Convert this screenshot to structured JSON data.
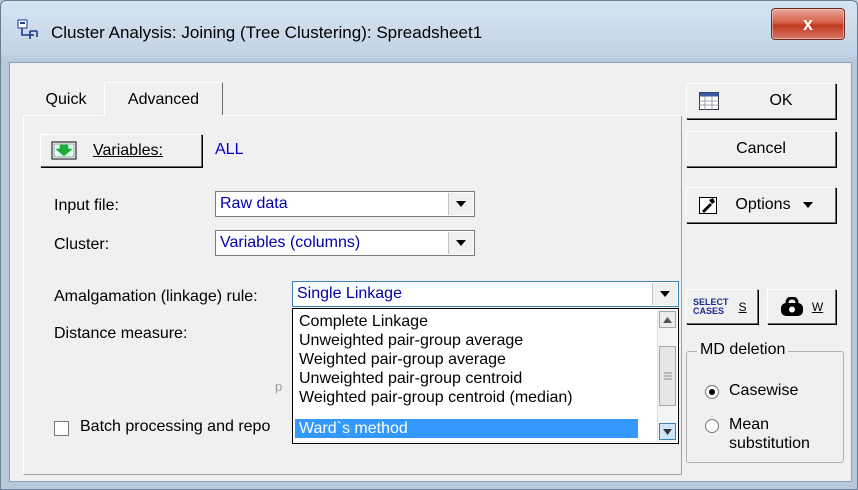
{
  "window": {
    "title": "Cluster Analysis: Joining (Tree Clustering): Spreadsheet1",
    "close_glyph": "x"
  },
  "tabs": [
    {
      "label": "Quick"
    },
    {
      "label": "Advanced"
    }
  ],
  "variables": {
    "button_label": "Variables:",
    "value": "ALL"
  },
  "input_file": {
    "label": "Input file:",
    "value": "Raw data"
  },
  "cluster": {
    "label": "Cluster:",
    "value": "Variables (columns)"
  },
  "amalgamation": {
    "label": "Amalgamation (linkage) rule:",
    "value": "Single Linkage",
    "options": [
      "Complete Linkage",
      "Unweighted pair-group average",
      "Weighted pair-group average",
      "Unweighted pair-group centroid",
      "Weighted pair-group centroid (median)",
      "Ward`s method"
    ],
    "selected_index": 5
  },
  "distance": {
    "label": "Distance measure:",
    "hidden_char": "p"
  },
  "batch": {
    "label": "Batch processing and repo",
    "checked": false
  },
  "actions": {
    "ok_label": "OK",
    "cancel_label": "Cancel",
    "options_label": "Options",
    "select_cases_text": "SELECT\nCASES",
    "select_cases_key": "S",
    "weight_key": "W"
  },
  "md_deletion": {
    "title": "MD deletion",
    "casewise_label": "Casewise",
    "mean_label": "Mean\nsubstitution",
    "selected": "Casewise"
  },
  "colors": {
    "link_blue": "#0000cc",
    "selection": "#3399ff",
    "close_red": "#c0391f"
  }
}
